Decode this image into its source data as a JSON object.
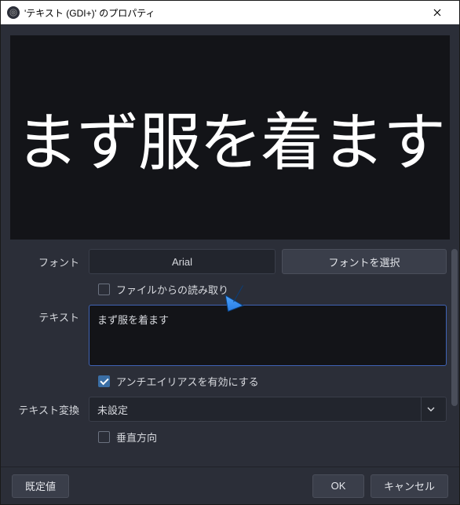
{
  "window": {
    "title": "'テキスト (GDI+)' のプロパティ"
  },
  "preview": {
    "text": "まず服を着ます"
  },
  "form": {
    "font_label": "フォント",
    "font_value": "Arial",
    "font_select_btn": "フォントを選択",
    "read_from_file_label": "ファイルからの読み取り",
    "read_from_file_checked": false,
    "text_label": "テキスト",
    "text_value": "まず服を着ます",
    "antialias_label": "アンチエイリアスを有効にする",
    "antialias_checked": true,
    "transform_label": "テキスト変換",
    "transform_value": "未設定",
    "vertical_label": "垂直方向",
    "vertical_checked": false
  },
  "footer": {
    "defaults": "既定値",
    "ok": "OK",
    "cancel": "キャンセル"
  }
}
